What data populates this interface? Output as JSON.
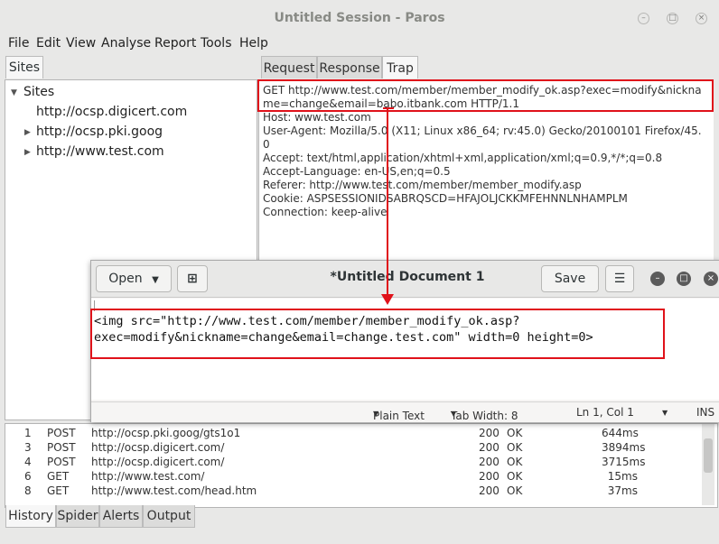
{
  "window": {
    "title": "Untitled Session - Paros"
  },
  "menu": [
    "File",
    "Edit",
    "View",
    "Analyse",
    "Report",
    "Tools",
    "Help"
  ],
  "sites": {
    "tab": "Sites",
    "root": "Sites",
    "items": [
      "http://ocsp.digicert.com",
      "http://ocsp.pki.goog",
      "http://www.test.com"
    ]
  },
  "right_tabs": [
    "Request",
    "Response",
    "Trap"
  ],
  "request": {
    "lines": [
      "GET http://www.test.com/member/member_modify_ok.asp?exec=modify&nickna",
      "me=change&email=babo.itbank.com HTTP/1.1",
      "Host: www.test.com",
      "User-Agent: Mozilla/5.0 (X11; Linux x86_64; rv:45.0) Gecko/20100101 Firefox/45.",
      "0",
      "Accept: text/html,application/xhtml+xml,application/xml;q=0.9,*/*;q=0.8",
      "Accept-Language: en-US,en;q=0.5",
      "Referer: http://www.test.com/member/member_modify.asp",
      "Cookie: ASPSESSIONIDSABRQSCD=HFAJOLJCKKMFEHNNLNHAMPLM",
      "Connection: keep-alive"
    ]
  },
  "history": {
    "rows": [
      {
        "id": "1",
        "method": "POST",
        "url": "http://ocsp.pki.goog/gts1o1",
        "code": "200",
        "status": "OK",
        "time": "644ms"
      },
      {
        "id": "3",
        "method": "POST",
        "url": "http://ocsp.digicert.com/",
        "code": "200",
        "status": "OK",
        "time": "3894ms"
      },
      {
        "id": "4",
        "method": "POST",
        "url": "http://ocsp.digicert.com/",
        "code": "200",
        "status": "OK",
        "time": "3715ms"
      },
      {
        "id": "6",
        "method": "GET",
        "url": "http://www.test.com/",
        "code": "200",
        "status": "OK",
        "time": "15ms"
      },
      {
        "id": "8",
        "method": "GET",
        "url": "http://www.test.com/head.htm",
        "code": "200",
        "status": "OK",
        "time": "37ms"
      }
    ]
  },
  "bottom_tabs": [
    "History",
    "Spider",
    "Alerts",
    "Output"
  ],
  "editor": {
    "open_label": "Open",
    "title": "*Untitled Document 1",
    "save_label": "Save",
    "code_lines": [
      "<img src=\"http://www.test.com/member/member_modify_ok.asp?",
      "exec=modify&nickname=change&email=change.test.com\" width=0 height=0>"
    ],
    "status": {
      "language": "Plain Text",
      "tab_width": "Tab Width: 8",
      "position": "Ln 1, Col 1",
      "mode": "INS"
    }
  },
  "colors": {
    "highlight": "#e0121a"
  }
}
